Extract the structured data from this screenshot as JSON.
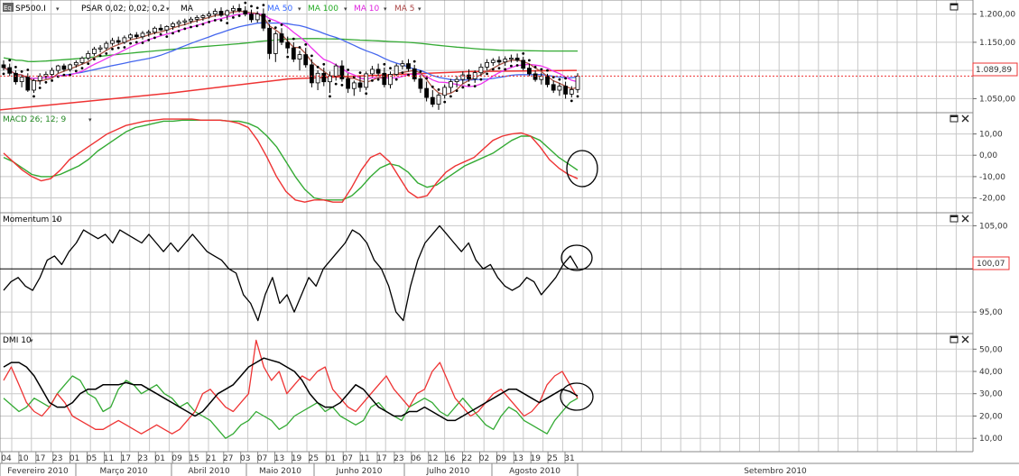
{
  "app": {
    "symbol_badge": "Eq",
    "symbol": "SP500.I",
    "psar_label": "PSAR 0,02; 0,02; 0,2",
    "ma_labels": [
      {
        "text": "MA 50",
        "color": "#3366ff"
      },
      {
        "text": "MA 100",
        "color": "#22aa22"
      },
      {
        "text": "MA 10",
        "color": "#dd22dd"
      },
      {
        "text": "MA 5",
        "color": "#aa4444"
      }
    ],
    "colors": {
      "grid": "#c8c8c8",
      "background": "#ffffff",
      "up": "#ffffff",
      "down": "#000000",
      "ma50": "#4466ee",
      "ma100": "#33aa33",
      "ma10": "#ee33ee",
      "ma5": "#aa5544",
      "ma200": "#ee3333",
      "macd": "#ee3333",
      "signal": "#33aa33",
      "momentum": "#000000",
      "dmi_plus": "#33aa33",
      "dmi_minus": "#ee3333",
      "adx": "#000000"
    }
  },
  "chart_data": [
    {
      "type": "candlestick",
      "title": "SP500.I",
      "yticks": [
        "1.200,00",
        "1.150,00",
        "1.100,00",
        "1.050,00"
      ],
      "ylim": [
        1025,
        1225
      ],
      "last_value_label": "1.089,89",
      "last_value": 1089.89,
      "candles": [
        [
          1110,
          1118,
          1100,
          1105
        ],
        [
          1105,
          1112,
          1090,
          1095
        ],
        [
          1095,
          1100,
          1075,
          1080
        ],
        [
          1080,
          1092,
          1070,
          1088
        ],
        [
          1088,
          1095,
          1062,
          1065
        ],
        [
          1065,
          1085,
          1060,
          1082
        ],
        [
          1082,
          1095,
          1075,
          1090
        ],
        [
          1090,
          1098,
          1085,
          1093
        ],
        [
          1093,
          1105,
          1088,
          1100
        ],
        [
          1100,
          1110,
          1095,
          1108
        ],
        [
          1108,
          1112,
          1098,
          1102
        ],
        [
          1102,
          1112,
          1098,
          1110
        ],
        [
          1110,
          1118,
          1105,
          1114
        ],
        [
          1114,
          1125,
          1110,
          1122
        ],
        [
          1122,
          1135,
          1118,
          1130
        ],
        [
          1130,
          1142,
          1126,
          1138
        ],
        [
          1138,
          1145,
          1132,
          1140
        ],
        [
          1140,
          1152,
          1136,
          1148
        ],
        [
          1148,
          1158,
          1144,
          1153
        ],
        [
          1153,
          1160,
          1146,
          1150
        ],
        [
          1150,
          1162,
          1147,
          1158
        ],
        [
          1158,
          1166,
          1154,
          1163
        ],
        [
          1163,
          1168,
          1156,
          1160
        ],
        [
          1160,
          1170,
          1155,
          1166
        ],
        [
          1166,
          1172,
          1160,
          1168
        ],
        [
          1168,
          1178,
          1164,
          1175
        ],
        [
          1175,
          1182,
          1170,
          1172
        ],
        [
          1172,
          1180,
          1166,
          1178
        ],
        [
          1178,
          1186,
          1172,
          1183
        ],
        [
          1183,
          1190,
          1176,
          1186
        ],
        [
          1186,
          1192,
          1180,
          1188
        ],
        [
          1188,
          1195,
          1183,
          1191
        ],
        [
          1191,
          1198,
          1185,
          1194
        ],
        [
          1194,
          1200,
          1188,
          1197
        ],
        [
          1197,
          1205,
          1192,
          1200
        ],
        [
          1200,
          1210,
          1195,
          1205
        ],
        [
          1205,
          1212,
          1195,
          1198
        ],
        [
          1198,
          1208,
          1190,
          1206
        ],
        [
          1206,
          1215,
          1200,
          1210
        ],
        [
          1210,
          1218,
          1203,
          1206
        ],
        [
          1206,
          1214,
          1196,
          1200
        ],
        [
          1200,
          1208,
          1185,
          1190
        ],
        [
          1190,
          1205,
          1185,
          1200
        ],
        [
          1200,
          1210,
          1170,
          1175
        ],
        [
          1175,
          1182,
          1120,
          1130
        ],
        [
          1130,
          1170,
          1115,
          1165
        ],
        [
          1165,
          1175,
          1145,
          1150
        ],
        [
          1150,
          1160,
          1130,
          1140
        ],
        [
          1140,
          1150,
          1115,
          1120
        ],
        [
          1120,
          1135,
          1100,
          1128
        ],
        [
          1128,
          1140,
          1105,
          1110
        ],
        [
          1110,
          1120,
          1070,
          1078
        ],
        [
          1078,
          1100,
          1065,
          1095
        ],
        [
          1095,
          1105,
          1072,
          1080
        ],
        [
          1080,
          1098,
          1060,
          1090
        ],
        [
          1090,
          1112,
          1082,
          1108
        ],
        [
          1108,
          1118,
          1080,
          1085
        ],
        [
          1085,
          1095,
          1060,
          1068
        ],
        [
          1068,
          1082,
          1055,
          1078
        ],
        [
          1078,
          1090,
          1062,
          1070
        ],
        [
          1070,
          1098,
          1065,
          1094
        ],
        [
          1094,
          1108,
          1088,
          1102
        ],
        [
          1102,
          1112,
          1090,
          1095
        ],
        [
          1095,
          1105,
          1070,
          1075
        ],
        [
          1075,
          1098,
          1068,
          1093
        ],
        [
          1093,
          1112,
          1090,
          1108
        ],
        [
          1108,
          1118,
          1102,
          1112
        ],
        [
          1112,
          1120,
          1098,
          1103
        ],
        [
          1103,
          1110,
          1080,
          1085
        ],
        [
          1085,
          1092,
          1060,
          1068
        ],
        [
          1068,
          1080,
          1045,
          1052
        ],
        [
          1052,
          1065,
          1035,
          1040
        ],
        [
          1040,
          1060,
          1030,
          1056
        ],
        [
          1056,
          1075,
          1050,
          1070
        ],
        [
          1070,
          1085,
          1060,
          1080
        ],
        [
          1080,
          1090,
          1070,
          1084
        ],
        [
          1084,
          1098,
          1076,
          1092
        ],
        [
          1092,
          1102,
          1080,
          1085
        ],
        [
          1085,
          1100,
          1078,
          1096
        ],
        [
          1096,
          1112,
          1090,
          1106
        ],
        [
          1106,
          1120,
          1100,
          1114
        ],
        [
          1114,
          1122,
          1108,
          1118
        ],
        [
          1118,
          1125,
          1110,
          1115
        ],
        [
          1115,
          1125,
          1108,
          1120
        ],
        [
          1120,
          1128,
          1114,
          1122
        ],
        [
          1122,
          1130,
          1115,
          1118
        ],
        [
          1118,
          1124,
          1100,
          1104
        ],
        [
          1104,
          1112,
          1090,
          1094
        ],
        [
          1094,
          1100,
          1080,
          1084
        ],
        [
          1084,
          1096,
          1075,
          1090
        ],
        [
          1090,
          1094,
          1070,
          1075
        ],
        [
          1075,
          1082,
          1060,
          1065
        ],
        [
          1065,
          1078,
          1055,
          1072
        ],
        [
          1072,
          1080,
          1050,
          1058
        ],
        [
          1058,
          1072,
          1052,
          1066
        ],
        [
          1066,
          1095,
          1060,
          1089.89
        ]
      ],
      "ma200": [
        1030,
        1060,
        1085,
        1098,
        1100
      ],
      "ma200_x": [
        0,
        190,
        320,
        520,
        639
      ]
    },
    {
      "type": "line",
      "title": "MACD 26; 12; 9",
      "yticks": [
        "10,00",
        "0,00",
        "-10,00",
        "-20,00"
      ],
      "ylim": [
        -27,
        20
      ],
      "series": [
        {
          "name": "MACD",
          "values": [
            1,
            -3,
            -7,
            -10,
            -12,
            -11,
            -7,
            -2,
            1,
            4,
            7,
            10,
            12,
            14,
            15,
            16,
            16.5,
            17,
            17,
            17,
            17,
            16.5,
            16.5,
            16.5,
            16,
            15,
            13,
            7,
            -1,
            -10,
            -17,
            -21,
            -22,
            -21,
            -21,
            -22,
            -22,
            -15,
            -7,
            -1,
            1,
            -3,
            -10,
            -17,
            -20,
            -19,
            -13,
            -8,
            -5,
            -3,
            -1,
            3,
            7,
            9,
            10,
            10.5,
            9,
            4,
            -2,
            -6,
            -9,
            -11
          ]
        },
        {
          "name": "Signal",
          "values": [
            -1,
            -3,
            -6,
            -9,
            -10,
            -10,
            -9,
            -7,
            -5,
            -2,
            2,
            5,
            8,
            11,
            13,
            14,
            15,
            16,
            16,
            16.5,
            16.5,
            16.5,
            16.5,
            16.5,
            16,
            16,
            15,
            13,
            9,
            4,
            -3,
            -10,
            -16,
            -20,
            -21,
            -21,
            -21,
            -19,
            -15,
            -10,
            -6,
            -4,
            -5,
            -8,
            -13,
            -15,
            -14,
            -11,
            -8,
            -5,
            -3,
            -1,
            1,
            4,
            7,
            9,
            9,
            7,
            3,
            -1,
            -4,
            -7
          ]
        }
      ]
    },
    {
      "type": "line",
      "title": "Momentum 10",
      "yticks": [
        "105,00",
        "95,00"
      ],
      "ylim": [
        92.5,
        106.5
      ],
      "last_value_label": "100,07",
      "last_value": 100.07,
      "reference_line": 100,
      "series": [
        {
          "name": "Momentum",
          "values": [
            97.5,
            98.5,
            99,
            98,
            97.5,
            99,
            101,
            101.5,
            100.5,
            102,
            103,
            104.5,
            104,
            103.5,
            104,
            103,
            104.5,
            104,
            103.5,
            103,
            104,
            103,
            102,
            103,
            102,
            103,
            104,
            103,
            102,
            101.5,
            101,
            100,
            99.5,
            97,
            96,
            94,
            97,
            99,
            96,
            97,
            95,
            97,
            99,
            98,
            100,
            101,
            102,
            103,
            104.5,
            104,
            103,
            101,
            100,
            98,
            95,
            94,
            98,
            101,
            103,
            104,
            105,
            104,
            103,
            102,
            103,
            101,
            100,
            100.5,
            99,
            98,
            97.5,
            98,
            99,
            98.5,
            97,
            98,
            99,
            100.5,
            101.5,
            100.07
          ]
        }
      ]
    },
    {
      "type": "line",
      "title": "DMI 10",
      "yticks": [
        "50,00",
        "40,00",
        "30,00",
        "20,00",
        "10,00"
      ],
      "ylim": [
        4,
        57
      ],
      "series": [
        {
          "name": "+DI",
          "values": [
            28,
            25,
            22,
            24,
            28,
            26,
            24,
            30,
            34,
            38,
            36,
            30,
            28,
            22,
            24,
            32,
            36,
            34,
            30,
            32,
            34,
            30,
            28,
            24,
            26,
            22,
            20,
            18,
            14,
            10,
            12,
            16,
            18,
            22,
            20,
            18,
            14,
            16,
            20,
            22,
            24,
            26,
            22,
            24,
            20,
            18,
            16,
            18,
            24,
            26,
            22,
            20,
            18,
            24,
            26,
            28,
            26,
            22,
            20,
            24,
            28,
            24,
            20,
            16,
            14,
            20,
            24,
            22,
            18,
            16,
            14,
            12,
            18,
            22,
            26,
            28
          ]
        },
        {
          "name": "-DI",
          "values": [
            36,
            42,
            34,
            26,
            22,
            20,
            24,
            30,
            26,
            20,
            18,
            16,
            14,
            14,
            16,
            18,
            16,
            14,
            12,
            14,
            16,
            14,
            12,
            14,
            18,
            22,
            30,
            32,
            28,
            24,
            22,
            26,
            30,
            54,
            42,
            36,
            40,
            30,
            34,
            38,
            36,
            40,
            42,
            32,
            28,
            24,
            22,
            26,
            30,
            34,
            38,
            32,
            28,
            24,
            30,
            32,
            40,
            44,
            36,
            28,
            24,
            20,
            22,
            26,
            30,
            32,
            28,
            24,
            20,
            22,
            26,
            34,
            38,
            40,
            34,
            28
          ]
        },
        {
          "name": "ADX",
          "values": [
            42,
            44,
            44,
            42,
            38,
            32,
            26,
            24,
            24,
            26,
            30,
            32,
            32,
            34,
            34,
            34,
            35,
            34,
            34,
            32,
            30,
            28,
            26,
            24,
            22,
            20,
            22,
            26,
            30,
            32,
            34,
            38,
            42,
            44,
            46,
            45,
            44,
            42,
            40,
            36,
            30,
            26,
            24,
            24,
            26,
            30,
            34,
            32,
            28,
            24,
            22,
            20,
            20,
            22,
            22,
            24,
            22,
            20,
            18,
            18,
            20,
            22,
            24,
            26,
            28,
            30,
            32,
            32,
            30,
            28,
            26,
            28,
            30,
            32,
            31,
            29
          ]
        }
      ]
    }
  ],
  "xaxis": {
    "days": [
      "04",
      "10",
      "17",
      "23",
      "01",
      "05",
      "11",
      "17",
      "23",
      "01",
      "09",
      "15",
      "21",
      "27",
      "03",
      "07",
      "13",
      "19",
      "25",
      "01",
      "07",
      "11",
      "17",
      "23",
      "06",
      "12",
      "16",
      "22",
      "02",
      "09",
      "13",
      "19",
      "25",
      "31"
    ],
    "months": [
      "Fevereiro 2010",
      "Março 2010",
      "Abril 2010",
      "Maio 2010",
      "Junho 2010",
      "Julho 2010",
      "Agosto 2010",
      "Setembro 2010"
    ]
  },
  "icons": {
    "window": "window-icon",
    "close": "close-icon"
  }
}
